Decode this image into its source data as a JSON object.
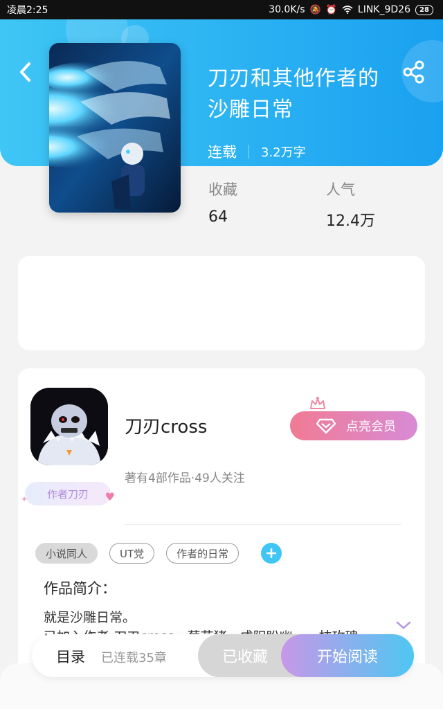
{
  "status_bar": {
    "time": "凌晨2:25",
    "net_speed": "30.0K/s",
    "wifi_name": "LINK_9D26",
    "battery": "28"
  },
  "book": {
    "title": "刀刃和其他作者的沙雕日常",
    "status": "连载",
    "word_count": "3.2万字",
    "stats": [
      {
        "label": "收藏",
        "value": "64"
      },
      {
        "label": "人气",
        "value": "12.4万"
      }
    ]
  },
  "author": {
    "name": "刀刃cross",
    "stats": "著有4部作品·49人关注",
    "tag": "作者刀刃",
    "vip_label": "点亮会员"
  },
  "tags": [
    "小说同人",
    "UT党",
    "作者的日常"
  ],
  "intro": {
    "heading": "作品简介：",
    "text": "就是沙雕日常。\n已加入作者:刀刃cross、葡花猪、成阳盼幽、一枝玫瑰"
  },
  "bottom_bar": {
    "toc_label": "目录",
    "chapter_count": "已连载35章",
    "fav_label": "已收藏",
    "read_label": "开始阅读"
  },
  "colors": {
    "header_start": "#3fc6f5",
    "header_end": "#1aa1f0",
    "vip_start": "#f07b93",
    "vip_end": "#d88bd6",
    "read_start": "#c797e8",
    "read_end": "#4ec7f2"
  },
  "icons": {
    "back": "chevron-left-icon",
    "share": "share-icon",
    "vip": "diamond-icon",
    "crown": "crown-icon",
    "add_tag": "plus-icon",
    "expand": "chevron-down-icon"
  }
}
